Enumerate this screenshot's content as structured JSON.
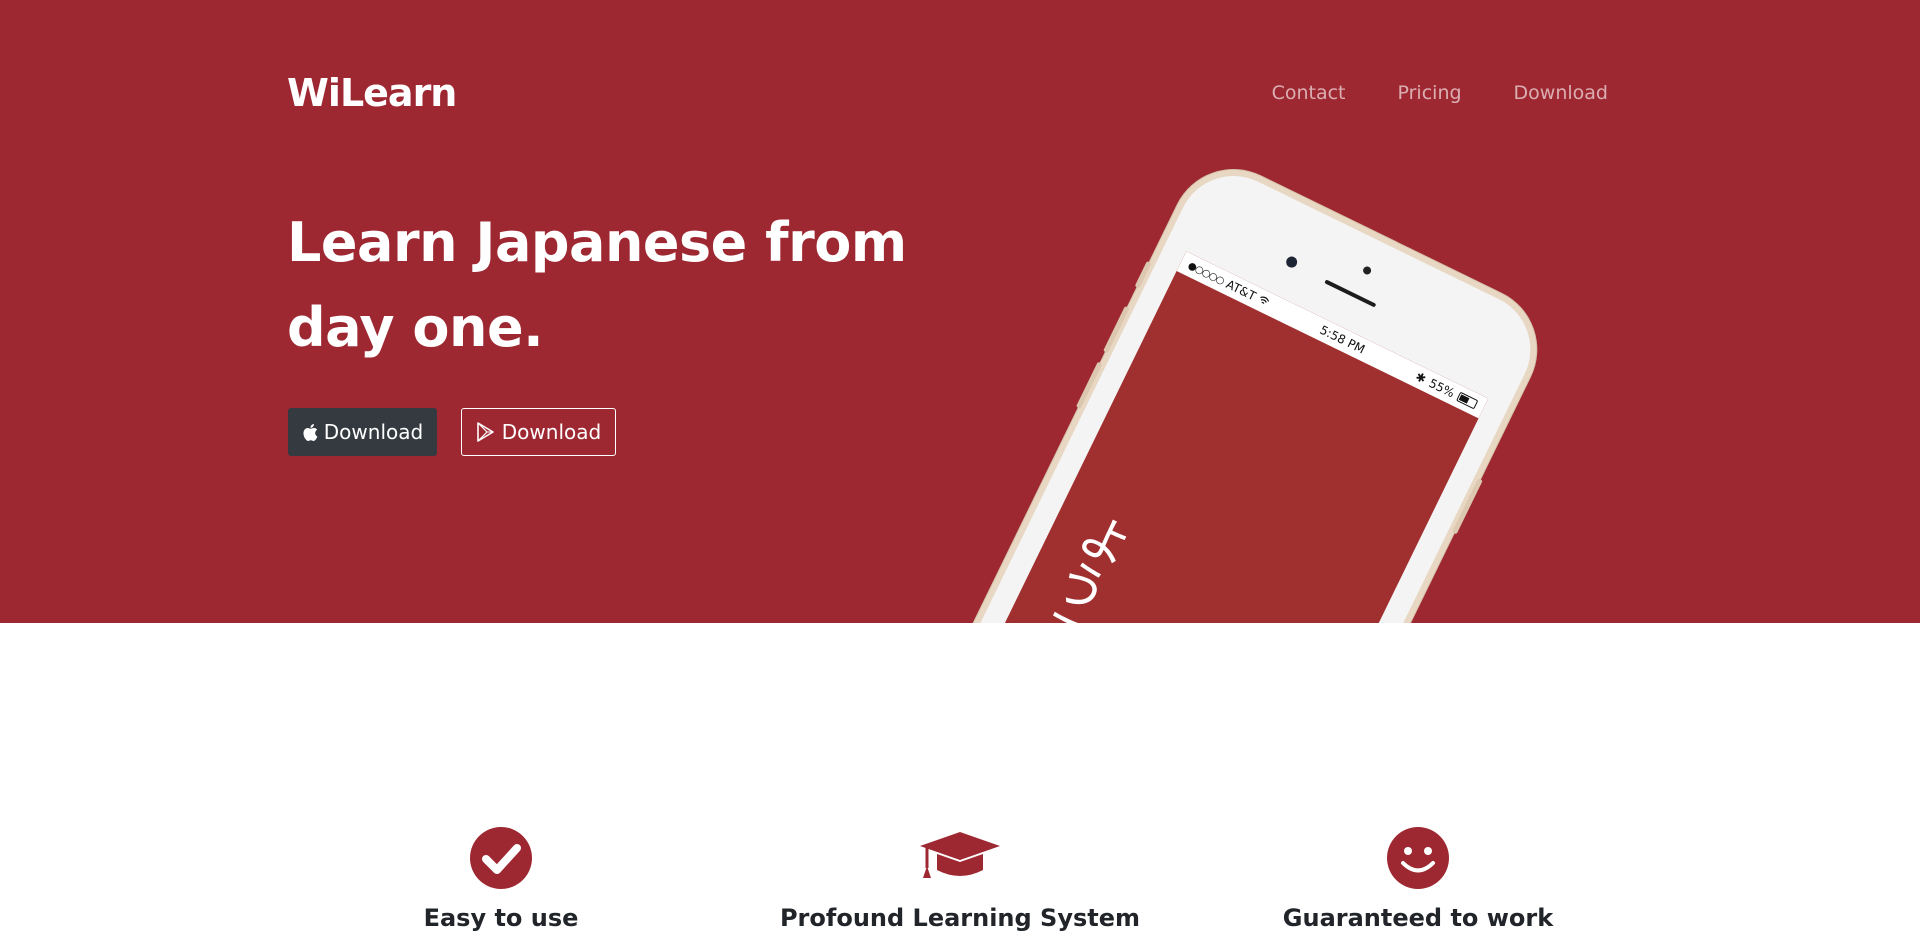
{
  "brand": {
    "name": "WiLearn"
  },
  "nav": {
    "items": [
      "Contact",
      "Pricing",
      "Download"
    ]
  },
  "hero": {
    "headline": "Learn Japanese from day one.",
    "buttons": {
      "apple_label": "Download",
      "play_label": "Download"
    },
    "background_color": "#9e2832"
  },
  "phone": {
    "carrier": "AT&T",
    "time": "5:58 PM",
    "battery": "55%",
    "screen_text": "ようこそ"
  },
  "features": [
    {
      "title": "Easy to use",
      "icon": "check-circle-icon"
    },
    {
      "title": "Profound Learning System",
      "icon": "graduation-cap-icon"
    },
    {
      "title": "Guaranteed to work",
      "icon": "smile-icon"
    }
  ],
  "colors": {
    "accent": "#9e2832",
    "dark_button": "#343a40"
  }
}
